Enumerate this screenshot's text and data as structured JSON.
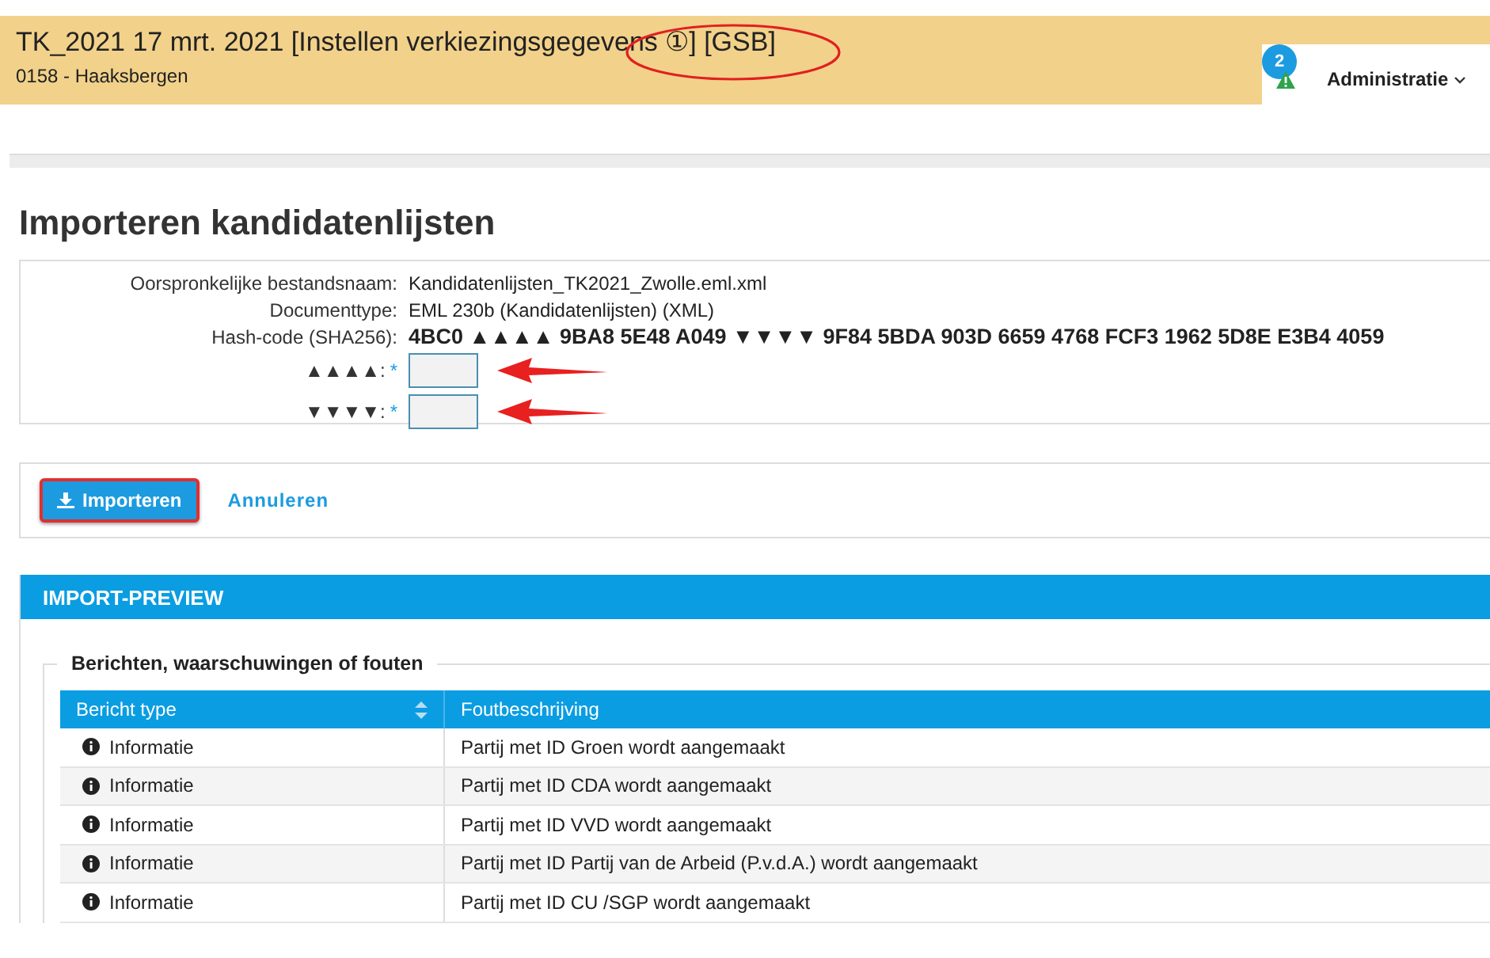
{
  "header": {
    "title": "TK_2021 17 mrt. 2021 [Instellen verkiezingsgegevens ①] [GSB]",
    "subtitle": "0158 - Haaksbergen",
    "notification_count": "2",
    "user_menu": "Administratie"
  },
  "page_title": "Importeren kandidatenlijsten",
  "details": [
    {
      "kind": "text",
      "label": "Oorspronkelijke bestandsnaam:",
      "value": "Kandidatenlijsten_TK2021_Zwolle.eml.xml"
    },
    {
      "kind": "text",
      "label": "Documenttype:",
      "value": "EML 230b (Kandidatenlijsten) (XML)"
    },
    {
      "kind": "hash",
      "label": "Hash-code (SHA256):",
      "value": "4BC0 ▲▲▲▲ 9BA8 5E48 A049 ▼▼▼▼ 9F84 5BDA 903D 6659 4768 FCF3 1962 5D8E E3B4 4059"
    },
    {
      "kind": "input",
      "label": "▲▲▲▲:",
      "required": "*"
    },
    {
      "kind": "input",
      "label": "▼▼▼▼:",
      "required": "*"
    }
  ],
  "actions": {
    "primary": "Importeren",
    "secondary": "Annuleren"
  },
  "preview": {
    "title": "IMPORT-PREVIEW",
    "fieldset": "Berichten, waarschuwingen of fouten",
    "columns": [
      "Bericht type",
      "Foutbeschrijving"
    ],
    "rows": [
      {
        "type": "Informatie",
        "description": "Partij met ID Groen wordt aangemaakt"
      },
      {
        "type": "Informatie",
        "description": "Partij met ID CDA wordt aangemaakt"
      },
      {
        "type": "Informatie",
        "description": "Partij met ID VVD wordt aangemaakt"
      },
      {
        "type": "Informatie",
        "description": "Partij met ID Partij van de Arbeid (P.v.d.A.) wordt aangemaakt"
      },
      {
        "type": "Informatie",
        "description": "Partij met ID CU /SGP wordt aangemaakt"
      }
    ]
  }
}
